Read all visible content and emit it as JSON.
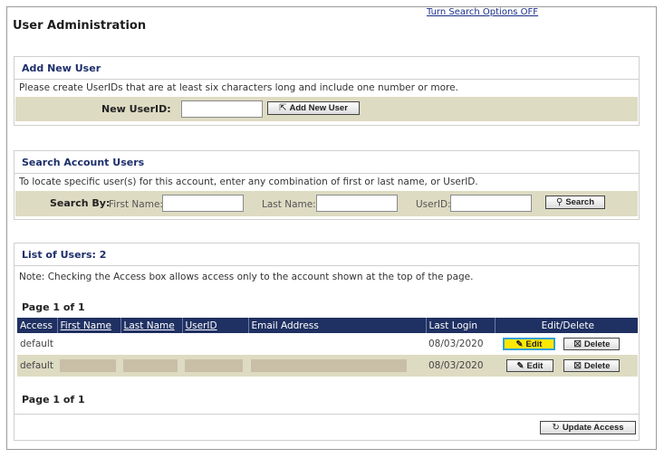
{
  "header": {
    "toggle_link": "Turn Search Options OFF",
    "title": "User Administration"
  },
  "add_user": {
    "heading": "Add New User",
    "note": "Please create UserIDs that are at least six characters long and include one number or more.",
    "new_userid_label": "New UserID:",
    "new_userid_value": "",
    "add_button": "Add New User"
  },
  "search": {
    "heading": "Search Account Users",
    "note": "To locate specific user(s) for this account, enter any combination of first or last name, or UserID.",
    "search_by_label": "Search By:",
    "first_name_label": "First Name:",
    "last_name_label": "Last Name:",
    "userid_label": "UserID:",
    "first_name_value": "",
    "last_name_value": "",
    "userid_value": "",
    "search_button": "Search"
  },
  "users": {
    "heading": "List of Users: 2",
    "note": "Note: Checking the Access box allows access only to the account shown at the top of the page.",
    "pager_top": "Page 1 of 1",
    "pager_bottom": "Page 1 of 1",
    "columns": [
      "Access",
      "First Name",
      "Last Name",
      "UserID",
      "Email Address",
      "Last Login",
      "Edit/Delete"
    ],
    "rows": [
      {
        "access": "default",
        "first": "",
        "last": "",
        "userid": "",
        "email": "",
        "last_login": "08/03/2020"
      },
      {
        "access": "default",
        "first": "",
        "last": "",
        "userid": "",
        "email": "",
        "last_login": "08/03/2020"
      }
    ],
    "edit_label": "Edit",
    "delete_label": "Delete",
    "update_button": "Update Access"
  }
}
